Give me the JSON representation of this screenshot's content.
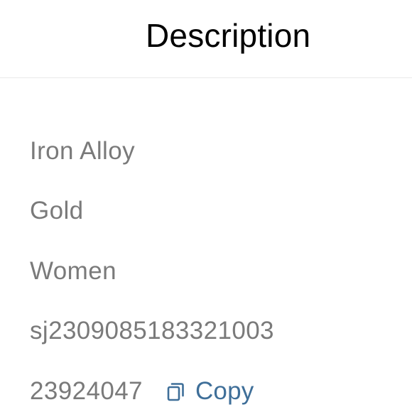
{
  "header": {
    "title": "Description"
  },
  "details": {
    "material": "Iron Alloy",
    "color": "Gold",
    "gender": "Women",
    "sku": "sj2309085183321003",
    "item_id": "23924047",
    "copy_label": "Copy"
  },
  "colors": {
    "title": "#000000",
    "detail_text": "#7a7a7a",
    "accent": "#3f6f99",
    "divider": "#e9e9e9"
  },
  "icons": {
    "copy": "copy-icon"
  }
}
